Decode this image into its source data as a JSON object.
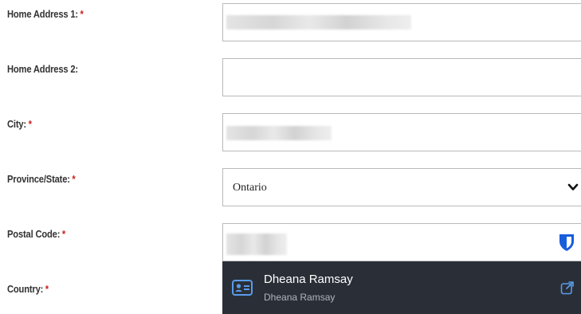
{
  "form": {
    "required_marker": "*",
    "home_address_1": {
      "label": "Home Address 1:",
      "value": ""
    },
    "home_address_2": {
      "label": "Home Address 2:",
      "value": ""
    },
    "city": {
      "label": "City:",
      "value": ""
    },
    "province_state": {
      "label": "Province/State:",
      "selected": "Ontario"
    },
    "postal_code": {
      "label": "Postal Code:",
      "value": ""
    },
    "country": {
      "label": "Country:"
    }
  },
  "autofill": {
    "name": "Dheana Ramsay",
    "subtitle": "Dheana Ramsay",
    "card_icon": "identity-card-icon",
    "popout_icon": "external-link-icon"
  },
  "icons": {
    "select_chevron": "chevron-down-icon",
    "password_manager": "bitwarden-shield-icon"
  },
  "colors": {
    "required": "#cc1f1f",
    "autofill_bg": "#2a2f37",
    "accent_blue": "#175ddc",
    "autofill_icon_blue": "#5a9bea"
  }
}
